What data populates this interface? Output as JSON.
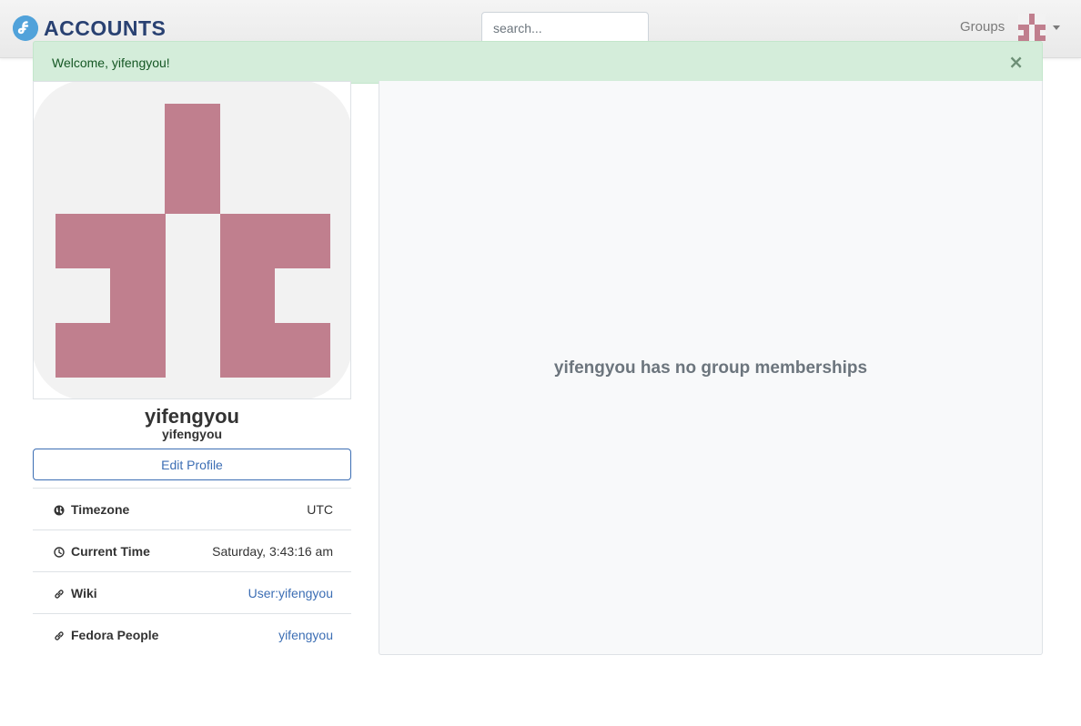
{
  "navbar": {
    "brand_text": "ACCOUNTS",
    "search_placeholder": "search...",
    "groups_label": "Groups"
  },
  "alert": {
    "message": "Welcome, yifengyou!",
    "close_symbol": "×"
  },
  "profile": {
    "display_name": "yifengyou",
    "username": "yifengyou",
    "edit_label": "Edit Profile",
    "avatar_color": "#c07f8e",
    "avatar_bg": "#f2f2f2",
    "info": [
      {
        "label": "Timezone",
        "value": "UTC",
        "icon": "globe-icon",
        "is_link": false
      },
      {
        "label": "Current Time",
        "value": "Saturday, 3:43:16 am",
        "icon": "clock-icon",
        "is_link": false
      },
      {
        "label": "Wiki",
        "value": "User:yifengyou",
        "icon": "link-icon",
        "is_link": true
      },
      {
        "label": "Fedora People",
        "value": "yifengyou",
        "icon": "link-icon",
        "is_link": true
      }
    ]
  },
  "groups": {
    "empty_message": "yifengyou has no group memberships"
  },
  "colors": {
    "brand": "#294172",
    "link": "#3c6eb4",
    "alert_bg": "#d4edda",
    "alert_text": "#155724"
  }
}
